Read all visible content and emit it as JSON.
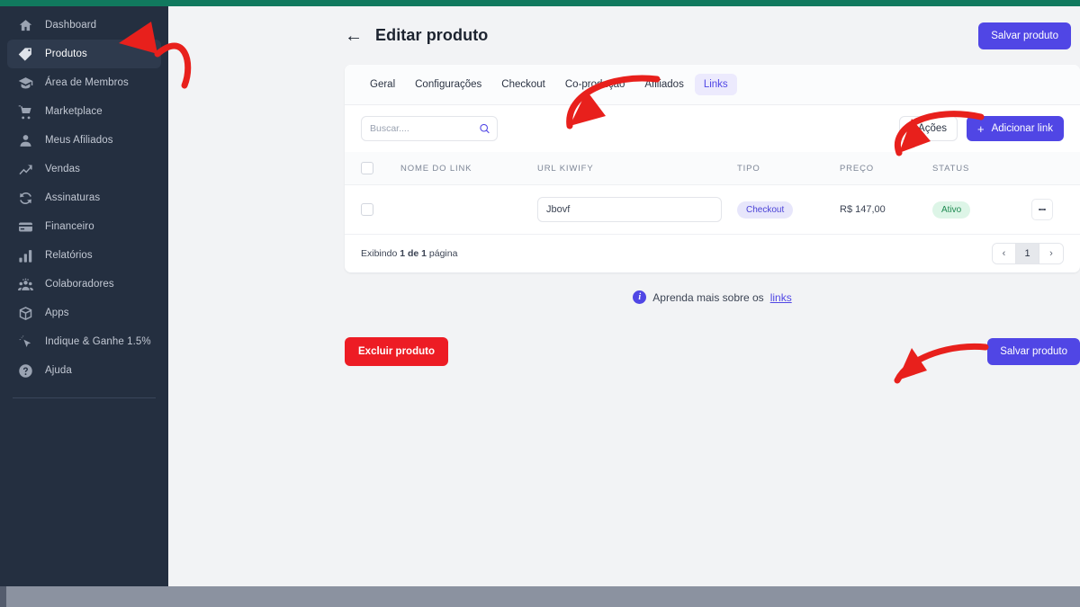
{
  "theme": {
    "topbar_green": "#11795e",
    "sidebar_bg": "#242f40",
    "accent_indigo": "#5046e5",
    "danger_red": "#ed1c24",
    "status_green": "#1f8a52",
    "annotation_red": "#e8201c"
  },
  "sidebar": {
    "items": [
      {
        "label": "Dashboard",
        "icon": "home-icon",
        "active": false
      },
      {
        "label": "Produtos",
        "icon": "tag-icon",
        "active": true
      },
      {
        "label": "Área de Membros",
        "icon": "graduation-cap-icon",
        "active": false
      },
      {
        "label": "Marketplace",
        "icon": "shopping-cart-icon",
        "active": false
      },
      {
        "label": "Meus Afiliados",
        "icon": "user-icon",
        "active": false
      },
      {
        "label": "Vendas",
        "icon": "trending-up-icon",
        "active": false
      },
      {
        "label": "Assinaturas",
        "icon": "refresh-cycle-icon",
        "active": false
      },
      {
        "label": "Financeiro",
        "icon": "credit-card-icon",
        "active": false
      },
      {
        "label": "Relatórios",
        "icon": "bar-chart-icon",
        "active": false
      },
      {
        "label": "Colaboradores",
        "icon": "people-group-icon",
        "active": false
      },
      {
        "label": "Apps",
        "icon": "box-icon",
        "active": false
      },
      {
        "label": "Indique & Ganhe 1.5%",
        "icon": "cursor-sparkle-icon",
        "active": false
      },
      {
        "label": "Ajuda",
        "icon": "question-circle-icon",
        "active": false
      }
    ]
  },
  "header": {
    "back_icon": "arrow-left-icon",
    "title": "Editar produto",
    "save_label": "Salvar produto"
  },
  "tabs": [
    {
      "label": "Geral",
      "active": false
    },
    {
      "label": "Configurações",
      "active": false
    },
    {
      "label": "Checkout",
      "active": false
    },
    {
      "label": "Co-produção",
      "active": false
    },
    {
      "label": "Afiliados",
      "active": false
    },
    {
      "label": "Links",
      "active": true
    }
  ],
  "toolbar": {
    "search_placeholder": "Buscar....",
    "search_value": "",
    "search_icon": "search-icon",
    "actions_label": "Ações",
    "actions_icon": "kebab-menu-icon",
    "add_label": "Adicionar link",
    "add_icon": "plus-icon"
  },
  "table": {
    "columns": [
      "NOME DO LINK",
      "URL KIWIFY",
      "TIPO",
      "PREÇO",
      "STATUS"
    ],
    "rows": [
      {
        "checked": false,
        "name": "",
        "url": "Jbovf",
        "tipo": "Checkout",
        "preco": "R$ 147,00",
        "status": "Ativo",
        "row_menu_icon": "kebab-menu-icon",
        "redacted": true
      }
    ]
  },
  "footer": {
    "showing_prefix": "Exibindo ",
    "showing_count": "1 de 1",
    "showing_suffix": " página",
    "prev_icon": "chevron-left-icon",
    "page_current": "1",
    "next_icon": "chevron-right-icon"
  },
  "learn_more": {
    "info_icon": "info-icon",
    "text": "Aprenda mais sobre os ",
    "link_label": "links"
  },
  "bottom_actions": {
    "delete_label": "Excluir produto",
    "save_label": "Salvar produto"
  }
}
